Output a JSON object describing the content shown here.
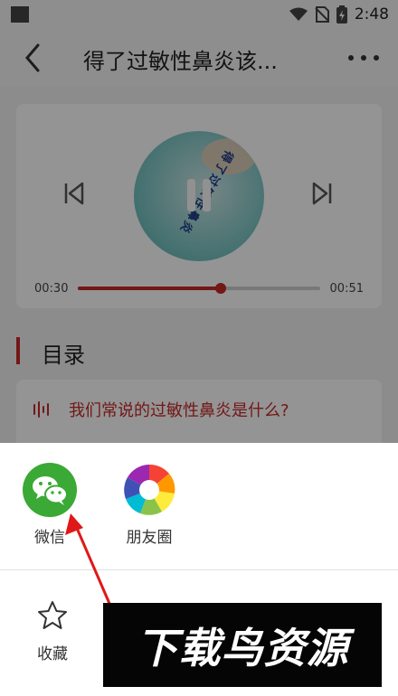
{
  "status_bar": {
    "time": "2:48"
  },
  "nav": {
    "title": "得了过敏性鼻炎该..."
  },
  "player": {
    "cover_text": "得了过敏性鼻炎",
    "current_time": "00:30",
    "total_time": "00:51",
    "progress": 0.59,
    "accent_color": "#c62828"
  },
  "toc": {
    "title": "目录",
    "first_episode": "我们常说的过敏性鼻炎是什么?"
  },
  "share": {
    "items": [
      {
        "label": "微信",
        "icon": "wechat-icon"
      },
      {
        "label": "朋友圈",
        "icon": "moments-icon"
      }
    ],
    "second_row": [
      {
        "label": "收藏",
        "icon": "star-icon"
      }
    ]
  },
  "watermark": {
    "text": "下载鸟资源"
  }
}
